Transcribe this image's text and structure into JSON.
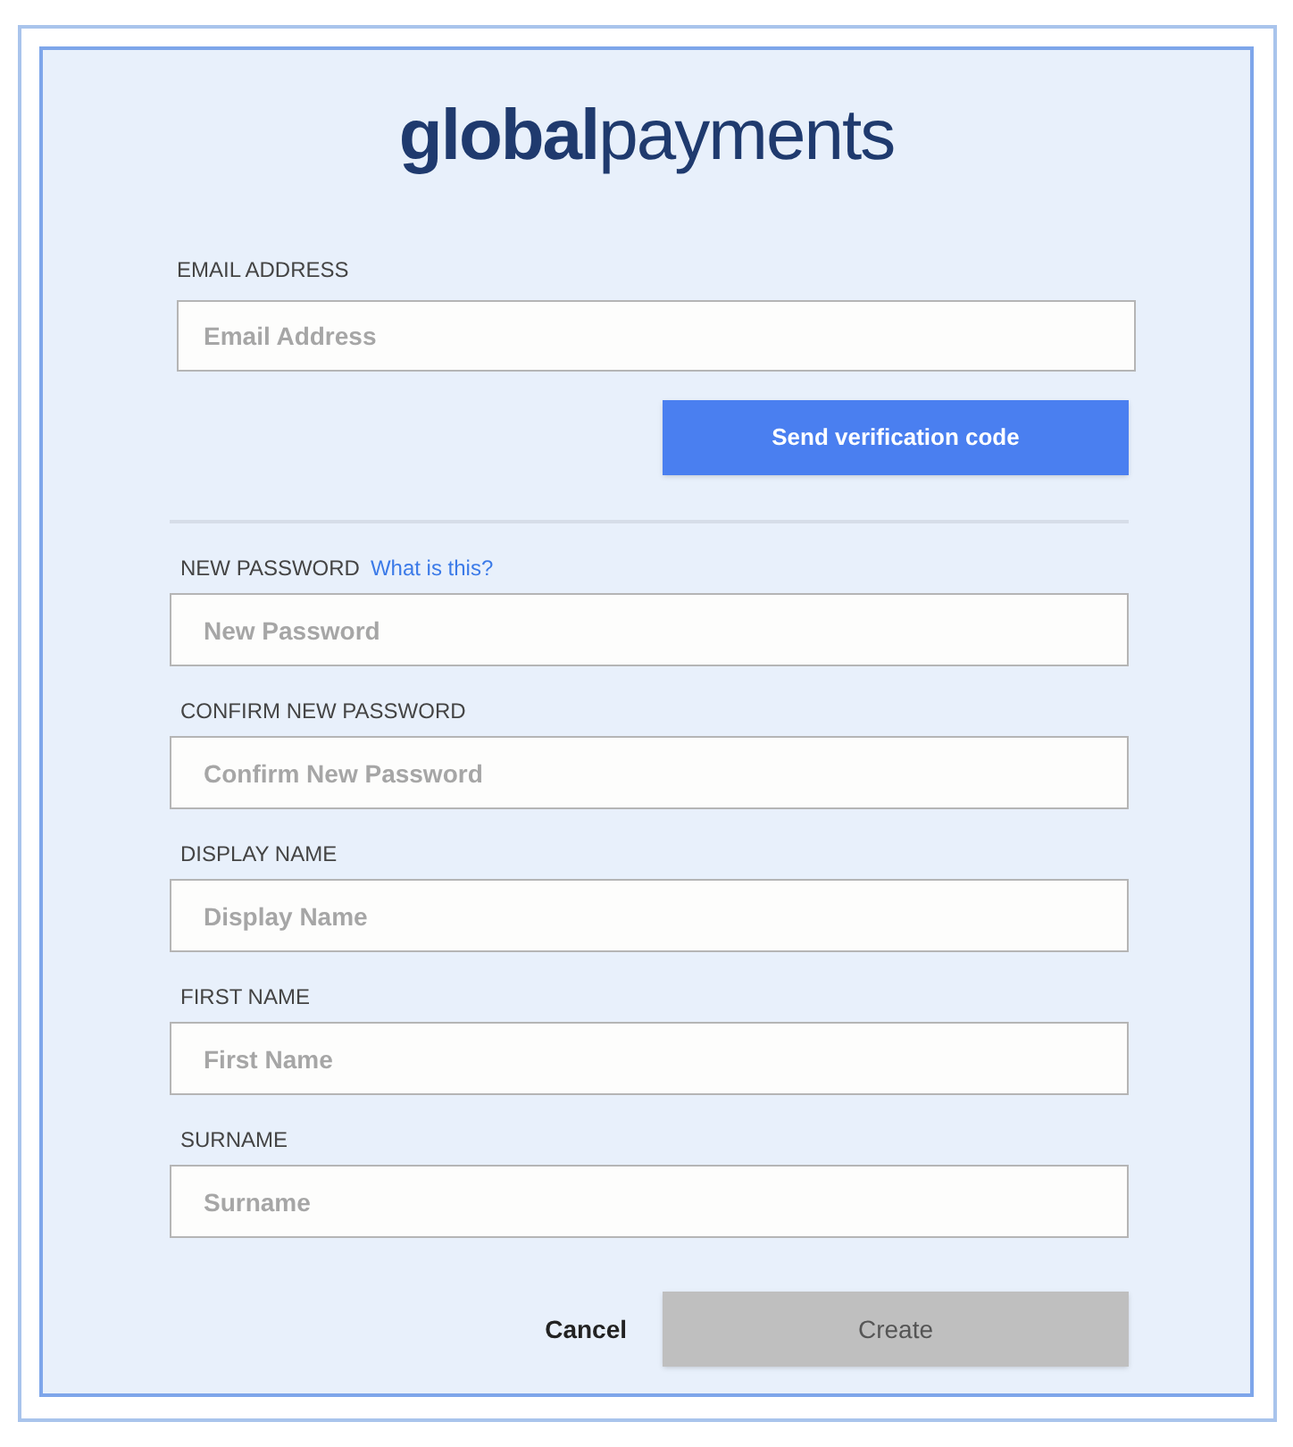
{
  "logo": {
    "bold_part": "global",
    "light_part": "payments"
  },
  "email": {
    "label": "EMAIL ADDRESS",
    "placeholder": "Email Address"
  },
  "send_button": {
    "label": "Send verification code",
    "disabled": false
  },
  "fields": [
    {
      "label": "NEW PASSWORD",
      "link": "What is this?",
      "placeholder": "New Password"
    },
    {
      "label": "CONFIRM NEW PASSWORD",
      "placeholder": "Confirm New Password"
    },
    {
      "label": "DISPLAY NAME",
      "placeholder": "Display Name"
    },
    {
      "label": "FIRST NAME",
      "placeholder": "First Name"
    },
    {
      "label": "SURNAME",
      "placeholder": "Surname"
    }
  ],
  "cancel_button": {
    "label": "Cancel"
  },
  "create_button": {
    "label": "Create",
    "disabled": true
  }
}
